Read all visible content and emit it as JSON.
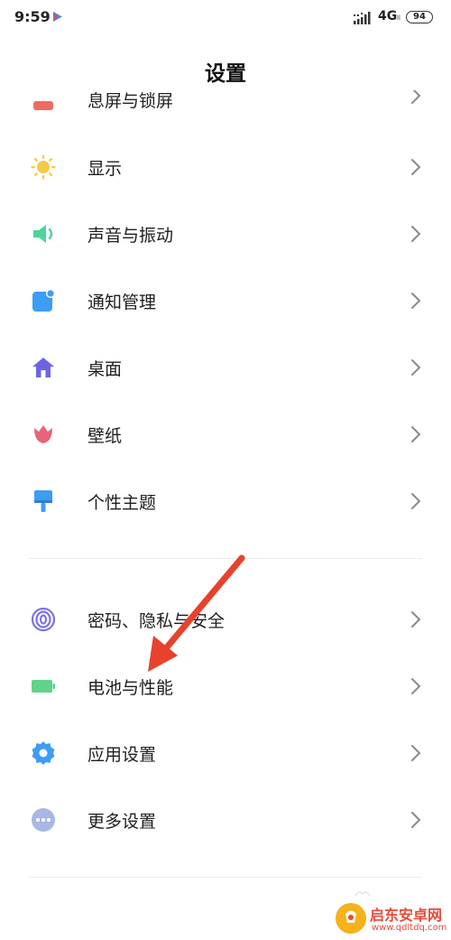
{
  "status_bar": {
    "time": "9:59",
    "network": "4G",
    "network_sub": "ll",
    "battery": "94"
  },
  "header": {
    "title": "设置",
    "partial_item_label": "息屏与锁屏"
  },
  "group1": [
    {
      "label": "显示",
      "icon": "sun-icon",
      "color": "#f7c948"
    },
    {
      "label": "声音与振动",
      "icon": "speaker-icon",
      "color": "#4cd59a"
    },
    {
      "label": "通知管理",
      "icon": "notification-icon",
      "color": "#3d9cf5"
    },
    {
      "label": "桌面",
      "icon": "home-icon",
      "color": "#6c63e6"
    },
    {
      "label": "壁纸",
      "icon": "tulip-icon",
      "color": "#e8647a"
    },
    {
      "label": "个性主题",
      "icon": "paint-roller-icon",
      "color": "#3d9cf5"
    }
  ],
  "group2": [
    {
      "label": "密码、隐私与安全",
      "icon": "fingerprint-icon",
      "color": "#7a74e8"
    },
    {
      "label": "电池与性能",
      "icon": "battery-icon",
      "color": "#5fd38a"
    },
    {
      "label": "应用设置",
      "icon": "gear-icon",
      "color": "#3d9cf5"
    },
    {
      "label": "更多设置",
      "icon": "more-icon",
      "color": "#a6b8e6"
    }
  ],
  "annotation": {
    "arrow_color": "#e8412c"
  },
  "watermark": {
    "text": "启东安卓网",
    "url": "www.qdltdq.com"
  }
}
